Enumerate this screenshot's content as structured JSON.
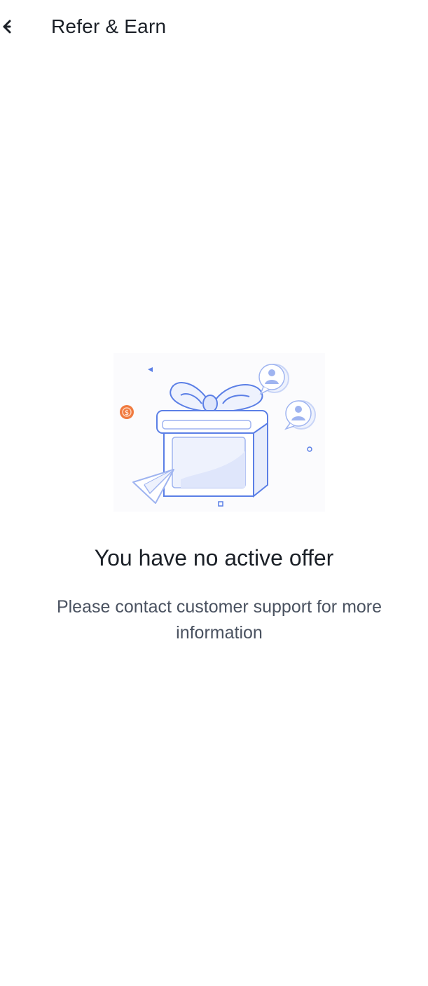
{
  "header": {
    "title": "Refer & Earn",
    "back_icon": "arrow-left-icon"
  },
  "empty_state": {
    "illustration_icon": "gift-box-illustration",
    "title": "You have no active offer",
    "description": "Please contact customer support for more information"
  },
  "colors": {
    "background": "#ffffff",
    "title_text": "#1b2027",
    "body_text": "#4a5260",
    "illustration_stroke": "#5b7fe6",
    "illustration_fill": "#e8edfb",
    "coin": "#f07a3f"
  }
}
